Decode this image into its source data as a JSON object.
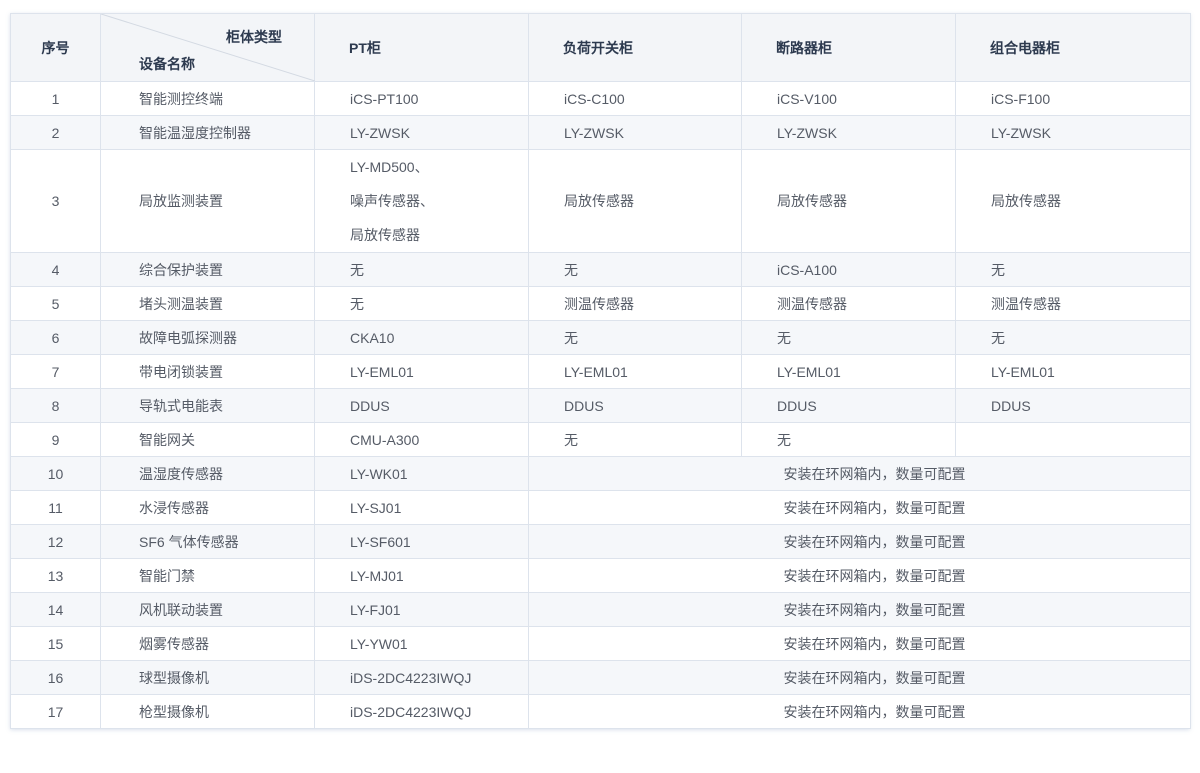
{
  "header": {
    "index": "序号",
    "diag_top": "柜体类型",
    "diag_bottom": "设备名称",
    "cols": [
      "PT柜",
      "负荷开关柜",
      "断路器柜",
      "组合电器柜"
    ]
  },
  "rows": [
    {
      "idx": "1",
      "name": "智能测控终端",
      "c": [
        "iCS-PT100",
        "iCS-C100",
        "iCS-V100",
        "iCS-F100"
      ]
    },
    {
      "idx": "2",
      "name": "智能温湿度控制器",
      "c": [
        "LY-ZWSK",
        "LY-ZWSK",
        "LY-ZWSK",
        "LY-ZWSK"
      ]
    },
    {
      "idx": "3",
      "name": "局放监测装置",
      "c_multi": [
        "LY-MD500、",
        "噪声传感器、",
        "局放传感器"
      ],
      "c": [
        "",
        "局放传感器",
        "局放传感器",
        "局放传感器"
      ]
    },
    {
      "idx": "4",
      "name": "综合保护装置",
      "c": [
        "无",
        "无",
        "iCS-A100",
        "无"
      ]
    },
    {
      "idx": "5",
      "name": "堵头测温装置",
      "c": [
        "无",
        "测温传感器",
        "测温传感器",
        "测温传感器"
      ]
    },
    {
      "idx": "6",
      "name": "故障电弧探测器",
      "c": [
        "CKA10",
        "无",
        "无",
        "无"
      ]
    },
    {
      "idx": "7",
      "name": "带电闭锁装置",
      "c": [
        "LY-EML01",
        "LY-EML01",
        "LY-EML01",
        "LY-EML01"
      ]
    },
    {
      "idx": "8",
      "name": "导轨式电能表",
      "c": [
        "DDUS",
        "DDUS",
        "DDUS",
        "DDUS"
      ]
    },
    {
      "idx": "9",
      "name": "智能网关",
      "c": [
        "CMU-A300",
        "无",
        "无",
        ""
      ]
    },
    {
      "idx": "10",
      "name": "温湿度传感器",
      "c": [
        "LY-WK01"
      ],
      "merged": "安装在环网箱内，数量可配置"
    },
    {
      "idx": "11",
      "name": "水浸传感器",
      "c": [
        "LY-SJ01"
      ],
      "merged": "安装在环网箱内，数量可配置"
    },
    {
      "idx": "12",
      "name": "SF6 气体传感器",
      "c": [
        "LY-SF601"
      ],
      "merged": "安装在环网箱内，数量可配置"
    },
    {
      "idx": "13",
      "name": "智能门禁",
      "c": [
        "LY-MJ01"
      ],
      "merged": "安装在环网箱内，数量可配置"
    },
    {
      "idx": "14",
      "name": "风机联动装置",
      "c": [
        "LY-FJ01"
      ],
      "merged": "安装在环网箱内，数量可配置"
    },
    {
      "idx": "15",
      "name": "烟雾传感器",
      "c": [
        "LY-YW01"
      ],
      "merged": "安装在环网箱内，数量可配置"
    },
    {
      "idx": "16",
      "name": "球型摄像机",
      "c": [
        "iDS-2DC4223IWQJ"
      ],
      "merged": "安装在环网箱内，数量可配置"
    },
    {
      "idx": "17",
      "name": "枪型摄像机",
      "c": [
        "iDS-2DC4223IWQJ"
      ],
      "merged": "安装在环网箱内，数量可配置"
    }
  ]
}
